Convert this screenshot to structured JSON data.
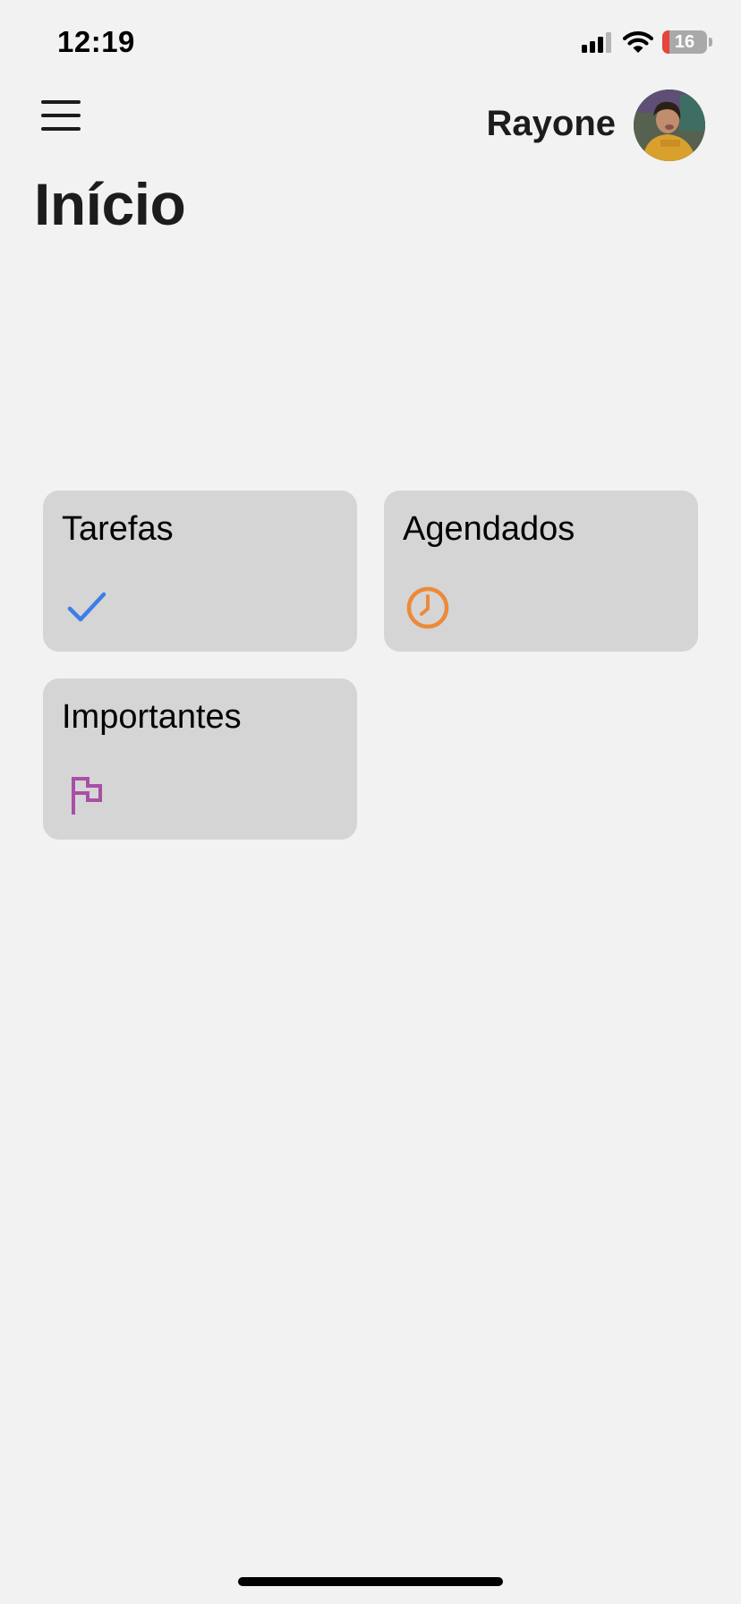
{
  "status_bar": {
    "time": "12:19",
    "battery_percent": "16",
    "battery_level": 0.16,
    "signal_icon": "cellular-signal-icon",
    "wifi_icon": "wifi-icon"
  },
  "header": {
    "menu_icon": "hamburger-menu-icon",
    "user_name": "Rayone",
    "page_title": "Início"
  },
  "categories": [
    {
      "label": "Tarefas",
      "icon": "checkmark-icon",
      "color": "#3d7de8"
    },
    {
      "label": "Agendados",
      "icon": "clock-icon",
      "color": "#ec8a3a"
    },
    {
      "label": "Importantes",
      "icon": "flag-icon",
      "color": "#a94fa6"
    }
  ],
  "colors": {
    "background": "#f2f2f2",
    "card_background": "#d5d5d5",
    "battery_low": "#e5453b"
  }
}
